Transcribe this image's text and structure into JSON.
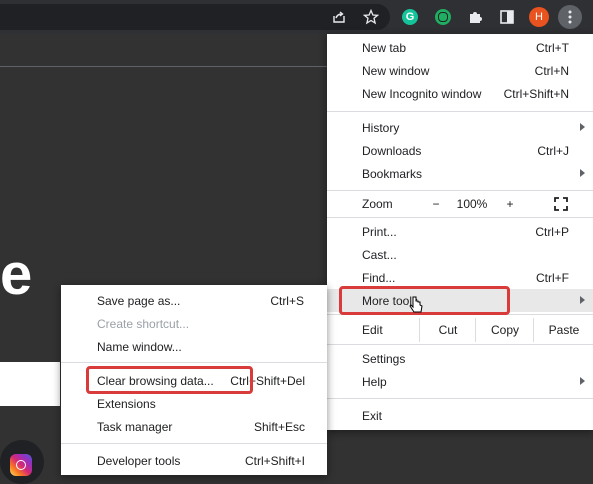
{
  "toolbar": {
    "profile_initial": "H",
    "icons": [
      "share-icon",
      "star-icon",
      "grammarly-icon",
      "extension-green-icon",
      "puzzle-icon",
      "sidepanel-icon",
      "kebab-menu-icon"
    ]
  },
  "page": {
    "big_letter": "e"
  },
  "main_menu": {
    "new_tab": {
      "label": "New tab",
      "shortcut": "Ctrl+T"
    },
    "new_window": {
      "label": "New window",
      "shortcut": "Ctrl+N"
    },
    "new_incognito": {
      "label": "New Incognito window",
      "shortcut": "Ctrl+Shift+N"
    },
    "history": {
      "label": "History"
    },
    "downloads": {
      "label": "Downloads",
      "shortcut": "Ctrl+J"
    },
    "bookmarks": {
      "label": "Bookmarks"
    },
    "zoom": {
      "label": "Zoom",
      "minus": "−",
      "value": "100%",
      "plus": "+"
    },
    "print": {
      "label": "Print...",
      "shortcut": "Ctrl+P"
    },
    "cast": {
      "label": "Cast..."
    },
    "find": {
      "label": "Find...",
      "shortcut": "Ctrl+F"
    },
    "more_tools": {
      "label": "More tools"
    },
    "edit": {
      "label": "Edit",
      "cut": "Cut",
      "copy": "Copy",
      "paste": "Paste"
    },
    "settings": {
      "label": "Settings"
    },
    "help": {
      "label": "Help"
    },
    "exit": {
      "label": "Exit"
    }
  },
  "sub_menu": {
    "save_page": {
      "label": "Save page as...",
      "shortcut": "Ctrl+S"
    },
    "create_shortcut": {
      "label": "Create shortcut..."
    },
    "name_window": {
      "label": "Name window..."
    },
    "clear_browsing": {
      "label": "Clear browsing data...",
      "shortcut": "Ctrl+Shift+Del"
    },
    "extensions": {
      "label": "Extensions"
    },
    "task_manager": {
      "label": "Task manager",
      "shortcut": "Shift+Esc"
    },
    "developer_tools": {
      "label": "Developer tools",
      "shortcut": "Ctrl+Shift+I"
    }
  },
  "colors": {
    "highlight": "#d93a3a",
    "profile": "#e8531f",
    "grammarly": "#15c39a"
  }
}
